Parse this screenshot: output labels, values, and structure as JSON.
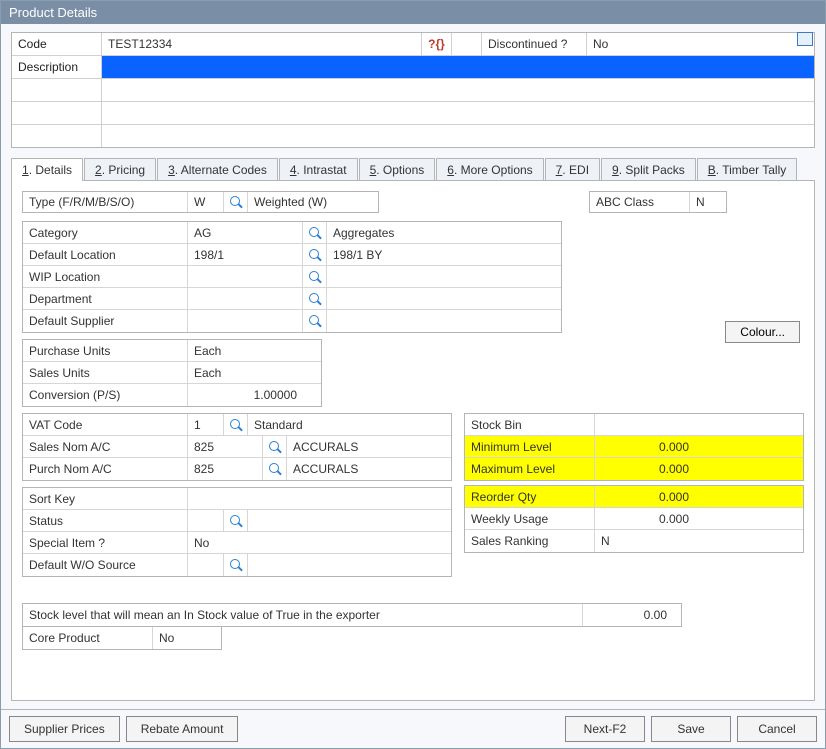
{
  "window": {
    "title": "Product Details"
  },
  "header": {
    "code_label": "Code",
    "code_value": "TEST12334",
    "help_icon": "?{}",
    "discontinued_label": "Discontinued ?",
    "discontinued_value": "No",
    "description_label": "Description"
  },
  "tabs": [
    {
      "label": "1. Details",
      "key": "1"
    },
    {
      "label": "2. Pricing",
      "key": "2"
    },
    {
      "label": "3. Alternate Codes",
      "key": "3"
    },
    {
      "label": "4. Intrastat",
      "key": "4"
    },
    {
      "label": "5. Options",
      "key": "5"
    },
    {
      "label": "6. More Options",
      "key": "6"
    },
    {
      "label": "7. EDI",
      "key": "7"
    },
    {
      "label": "9. Split Packs",
      "key": "9"
    },
    {
      "label": "B. Timber Tally",
      "key": "B"
    }
  ],
  "type_row": {
    "label": "Type (F/R/M/B/S/O)",
    "code": "W",
    "desc": "Weighted (W)"
  },
  "abc": {
    "label": "ABC Class",
    "value": "N"
  },
  "category": {
    "label": "Category",
    "value": "AG",
    "desc": "Aggregates"
  },
  "default_location": {
    "label": "Default Location",
    "value": "198/1",
    "desc": "198/1 BY"
  },
  "wip_location": {
    "label": "WIP Location",
    "value": "",
    "desc": ""
  },
  "department": {
    "label": "Department",
    "value": "",
    "desc": ""
  },
  "default_supplier": {
    "label": "Default Supplier",
    "value": "",
    "desc": ""
  },
  "purchase_units": {
    "label": "Purchase Units",
    "value": "Each"
  },
  "sales_units": {
    "label": "Sales Units",
    "value": "Each"
  },
  "conversion": {
    "label": "Conversion (P/S)",
    "value": "1.00000"
  },
  "vat_code": {
    "label": "VAT Code",
    "value": "1",
    "desc": "Standard"
  },
  "sales_nom": {
    "label": "Sales Nom A/C",
    "value": "825",
    "desc": "ACCURALS"
  },
  "purch_nom": {
    "label": "Purch Nom A/C",
    "value": "825",
    "desc": "ACCURALS"
  },
  "sort_key": {
    "label": "Sort Key",
    "value": ""
  },
  "status": {
    "label": "Status",
    "value": ""
  },
  "special_item": {
    "label": "Special Item ?",
    "value": "No"
  },
  "default_wo": {
    "label": "Default W/O Source",
    "value": ""
  },
  "stock_bin": {
    "label": "Stock Bin",
    "value": ""
  },
  "min_level": {
    "label": "Minimum Level",
    "value": "0.000"
  },
  "max_level": {
    "label": "Maximum Level",
    "value": "0.000"
  },
  "reorder_qty": {
    "label": "Reorder Qty",
    "value": "0.000"
  },
  "weekly_usage": {
    "label": "Weekly Usage",
    "value": "0.000"
  },
  "sales_ranking": {
    "label": "Sales Ranking",
    "value": "N"
  },
  "colour_btn": "Colour...",
  "stock_level": {
    "label": "Stock level that will mean an In Stock value of True in the exporter",
    "value": "0.00"
  },
  "core_product": {
    "label": "Core Product",
    "value": "No"
  },
  "footer": {
    "supplier_prices": "Supplier Prices",
    "rebate_amount": "Rebate Amount",
    "next": "Next-F2",
    "save": "Save",
    "cancel": "Cancel"
  }
}
